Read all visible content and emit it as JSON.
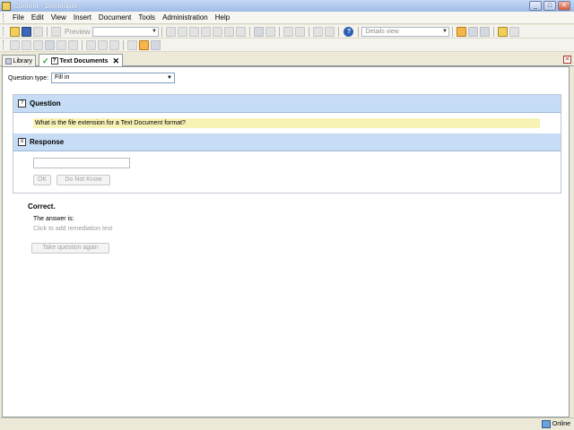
{
  "window": {
    "title": "Content - Developer"
  },
  "menu": [
    "File",
    "Edit",
    "View",
    "Insert",
    "Document",
    "Tools",
    "Administration",
    "Help"
  ],
  "toolbar": {
    "preview_label": "Preview",
    "view_select": "Details view"
  },
  "tabs": [
    {
      "label": "Library"
    },
    {
      "label": "Text Documents"
    }
  ],
  "question_type": {
    "label": "Question type:",
    "value": "Fill in"
  },
  "question": {
    "header": "Question",
    "text": "What is the file extension for a Text Document format?"
  },
  "response": {
    "header": "Response",
    "input_value": "",
    "ok_label": "OK",
    "dnk_label": "Do Not Know"
  },
  "feedback": {
    "correct": "Correct.",
    "answer_is": "The answer is:",
    "remediation": "Click to add remediation text",
    "retake_label": "Take question again"
  },
  "status": {
    "online": "Online"
  }
}
